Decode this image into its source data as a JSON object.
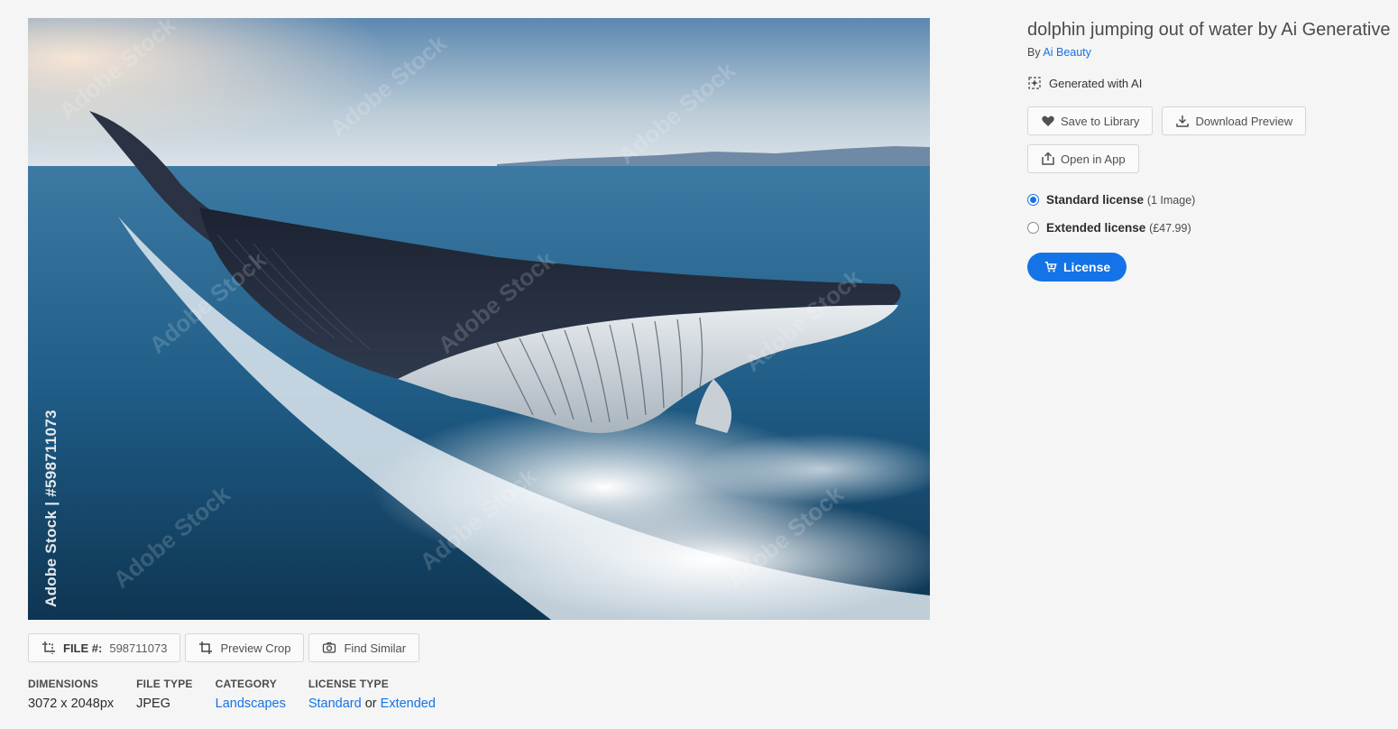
{
  "image": {
    "side_watermark": "Adobe Stock | #598711073",
    "tile_watermark": "Adobe Stock"
  },
  "toolbar": {
    "file_label": "FILE #:",
    "file_number": "598711073",
    "preview_crop": "Preview Crop",
    "find_similar": "Find Similar"
  },
  "meta": {
    "dimensions_label": "DIMENSIONS",
    "dimensions_value": "3072 x 2048px",
    "filetype_label": "FILE TYPE",
    "filetype_value": "JPEG",
    "category_label": "CATEGORY",
    "category_value": "Landscapes",
    "licensetype_label": "LICENSE TYPE",
    "license_standard": "Standard",
    "license_or": "or",
    "license_extended": "Extended"
  },
  "panel": {
    "title": "dolphin jumping out of water by Ai Generative",
    "by_label": "By",
    "author": "Ai Beauty",
    "ai_badge": "Generated with AI",
    "save_to_library": "Save to Library",
    "download_preview": "Download Preview",
    "open_in_app": "Open in App",
    "standard_license": "Standard license",
    "standard_detail": "(1 Image)",
    "extended_license": "Extended license",
    "extended_detail": "(£47.99)",
    "license_button": "License"
  },
  "colors": {
    "accent": "#1473e6",
    "background": "#f5f5f5"
  },
  "icons": [
    "crop-file-icon",
    "crop-icon",
    "camera-icon",
    "ai-sparkle-icon",
    "heart-icon",
    "download-icon",
    "share-icon",
    "cart-icon"
  ]
}
